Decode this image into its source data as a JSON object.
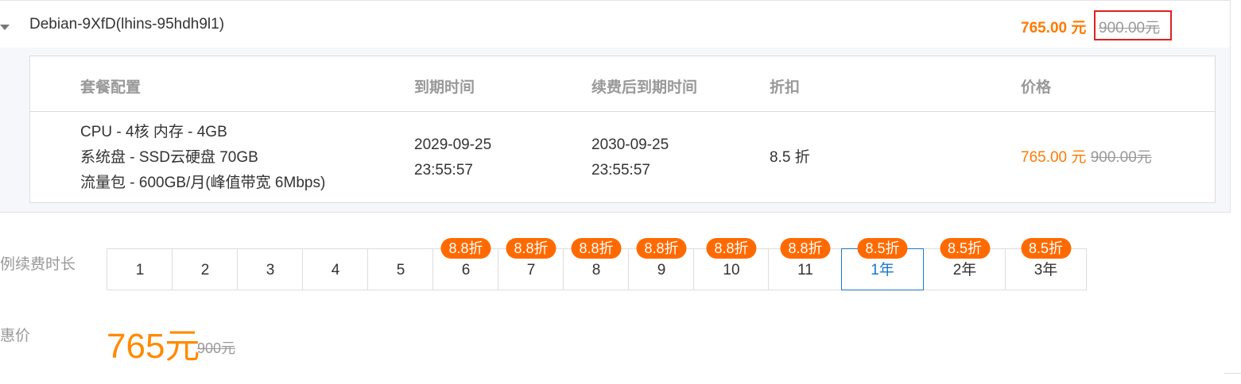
{
  "instance": {
    "name": "Debian-9XfD(lhins-95hdh9l1)",
    "price": "765.00 元",
    "original_price": "900.00元"
  },
  "table": {
    "headers": [
      "套餐配置",
      "到期时间",
      "续费后到期时间",
      "折扣",
      "价格"
    ],
    "row": {
      "config": [
        "CPU - 4核 内存 - 4GB",
        "系统盘 - SSD云硬盘 70GB",
        "流量包 - 600GB/月(峰值带宽 6Mbps)"
      ],
      "expire": [
        "2029-09-25",
        "23:55:57"
      ],
      "renew_expire": [
        "2030-09-25",
        "23:55:57"
      ],
      "discount": "8.5 折",
      "price": "765.00 元",
      "original_price": "900.00元"
    }
  },
  "renew": {
    "label": "例续费时长",
    "options": [
      {
        "label": "1",
        "badge": ""
      },
      {
        "label": "2",
        "badge": ""
      },
      {
        "label": "3",
        "badge": ""
      },
      {
        "label": "4",
        "badge": ""
      },
      {
        "label": "5",
        "badge": ""
      },
      {
        "label": "6",
        "badge": "8.8折"
      },
      {
        "label": "7",
        "badge": "8.8折"
      },
      {
        "label": "8",
        "badge": "8.8折"
      },
      {
        "label": "9",
        "badge": "8.8折"
      },
      {
        "label": "10",
        "badge": "8.8折"
      },
      {
        "label": "11",
        "badge": "8.8折"
      },
      {
        "label": "1年",
        "badge": "8.5折"
      },
      {
        "label": "2年",
        "badge": "8.5折"
      },
      {
        "label": "3年",
        "badge": "8.5折"
      }
    ],
    "selected": "1年"
  },
  "promo": {
    "label": "惠价",
    "price": "765元",
    "original_price": "900元"
  },
  "colors": {
    "accent_orange": "#ff7a00",
    "badge_orange": "#ff6a00",
    "selected_blue": "#1a78c9",
    "highlight_red": "#e02020"
  }
}
